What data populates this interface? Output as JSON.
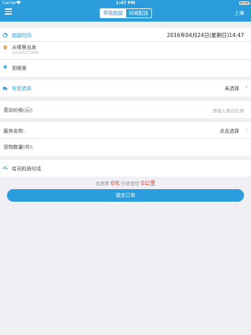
{
  "status_bar": {
    "carrier": "Carrier",
    "time": "1:47 PM"
  },
  "nav": {
    "tabs": [
      {
        "label": "帮我跑腿",
        "active": true
      },
      {
        "label": "同城配送",
        "active": false
      }
    ],
    "city": "上海"
  },
  "form": {
    "errand_time": {
      "label": "跑腿时间",
      "value": "2016年04月24日(星期日)14:47"
    },
    "from": {
      "label": "从哪里出发",
      "phone": "(15183277266)"
    },
    "to": {
      "label": "到哪里"
    },
    "vehicle": {
      "label": "车型选择",
      "value": "未选择"
    },
    "price": {
      "label": "意向价格(元):",
      "placeholder": "请输入意向价格"
    },
    "service": {
      "label": "服务名称:",
      "value": "点击选择"
    },
    "quantity": {
      "label": "货物数量(件):"
    },
    "message": {
      "label": "给司机捎句话"
    }
  },
  "summary": {
    "total_label": "总路费",
    "total_value": "0元",
    "distance_label": "行驶里程",
    "distance_value": "0公里"
  },
  "submit_label": "提交订单",
  "colors": {
    "brand": "#2b9ddc",
    "price_red": "#e8352a",
    "background": "#efeff4"
  },
  "icons": [
    "menu-icon",
    "clock-icon",
    "location-pin-icon",
    "diamond-pin-icon",
    "truck-icon",
    "chevron-right-icon",
    "message-dots-icon"
  ]
}
